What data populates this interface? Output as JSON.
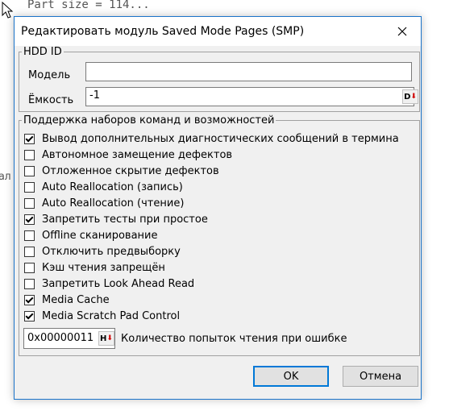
{
  "background": {
    "top_text": "Part size  = 114...",
    "side_text": "ал"
  },
  "dialog": {
    "title": "Редактировать модуль Saved Mode Pages (SMP)",
    "close_icon": "close-icon",
    "hdd_group": {
      "legend": "HDD ID",
      "model_label": "Модель",
      "model_value": "",
      "capacity_label": "Ёмкость",
      "capacity_value": "-1",
      "capacity_button": {
        "letter": "D",
        "arrow": "⬇"
      }
    },
    "support_group": {
      "legend": "Поддержка наборов команд и возможностей",
      "options": [
        {
          "label": "Вывод дополнительных диагностических сообщений в термина",
          "checked": true
        },
        {
          "label": "Автономное замещение дефектов",
          "checked": false
        },
        {
          "label": "Отложенное скрытие дефектов",
          "checked": false
        },
        {
          "label": "Auto Reallocation (запись)",
          "checked": false
        },
        {
          "label": "Auto Reallocation (чтение)",
          "checked": false
        },
        {
          "label": "Запретить тесты при простое",
          "checked": true
        },
        {
          "label": "Offline сканирование",
          "checked": false
        },
        {
          "label": "Отключить предвыборку",
          "checked": false
        },
        {
          "label": "Кэш чтения запрещён",
          "checked": false
        },
        {
          "label": "Запретить Look Ahead Read",
          "checked": false
        },
        {
          "label": "Media Cache",
          "checked": true
        },
        {
          "label": "Media Scratch Pad Control",
          "checked": true
        }
      ],
      "retry_value": "0x00000011",
      "retry_button": {
        "letter": "H",
        "arrow": "⬇"
      },
      "retry_label": "Количество попыток чтения при ошибке"
    },
    "ok_label": "OK",
    "cancel_label": "Отмена",
    "accent_color": "#0078d7"
  }
}
